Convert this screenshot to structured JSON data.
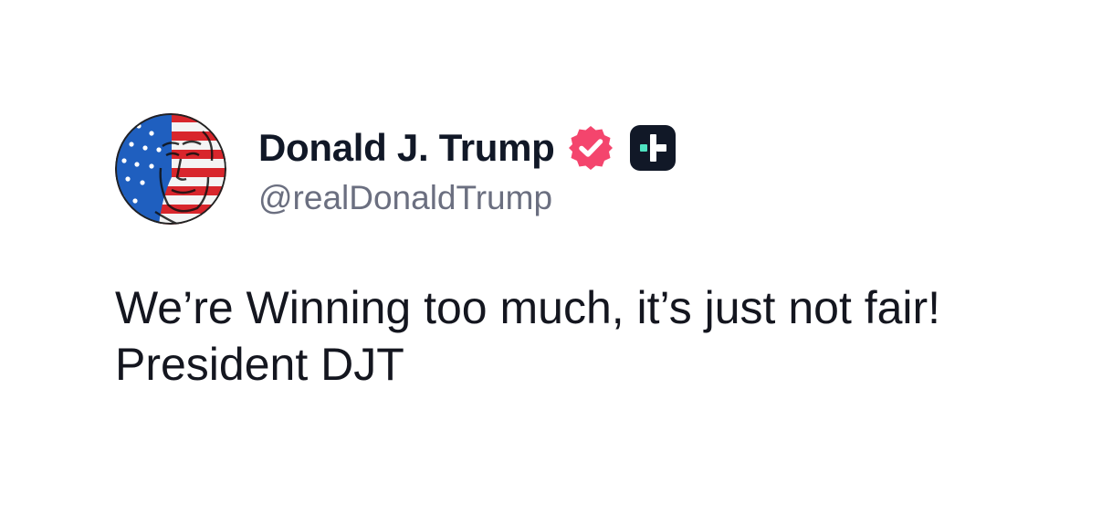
{
  "post": {
    "author": {
      "display_name": "Donald J. Trump",
      "handle": "@realDonaldTrump",
      "avatar_icon": "american-flag-portrait-avatar",
      "verified_icon": "verified-badge-icon",
      "verified_color": "#f4456d",
      "badge_icon": "plus-badge-icon",
      "badge_color": "#111827",
      "badge_accent": "#4fe3c1"
    },
    "body": {
      "line1": "We’re Winning too much, it’s just not fair!",
      "line2": "President DJT"
    }
  }
}
